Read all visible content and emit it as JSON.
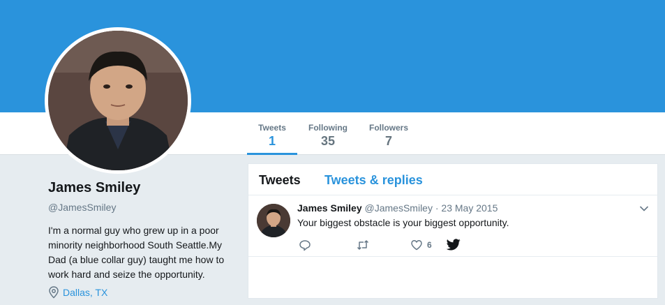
{
  "profile": {
    "name": "James Smiley",
    "handle": "@JamesSmiley",
    "bio": "I'm a normal guy who grew up in a poor minority neighborhood South Seattle.My Dad (a blue collar guy) taught me how to work hard and seize the opportunity.",
    "location": "Dallas, TX"
  },
  "stats": [
    {
      "label": "Tweets",
      "value": "1"
    },
    {
      "label": "Following",
      "value": "35"
    },
    {
      "label": "Followers",
      "value": "7"
    }
  ],
  "timeline": {
    "tabs": [
      "Tweets",
      "Tweets & replies"
    ]
  },
  "tweet": {
    "name": "James Smiley",
    "handle": "@JamesSmiley",
    "dot": "·",
    "date": "23 May 2015",
    "text": "Your biggest obstacle is your biggest opportunity.",
    "likes": "6"
  },
  "colors": {
    "banner": "#2a93dc",
    "accent": "#2a93dc",
    "page_bg": "#e6ecf0"
  },
  "icons": [
    "location-pin-icon",
    "chevron-down-icon",
    "reply-icon",
    "retweet-icon",
    "heart-icon",
    "twitter-bird-icon"
  ]
}
